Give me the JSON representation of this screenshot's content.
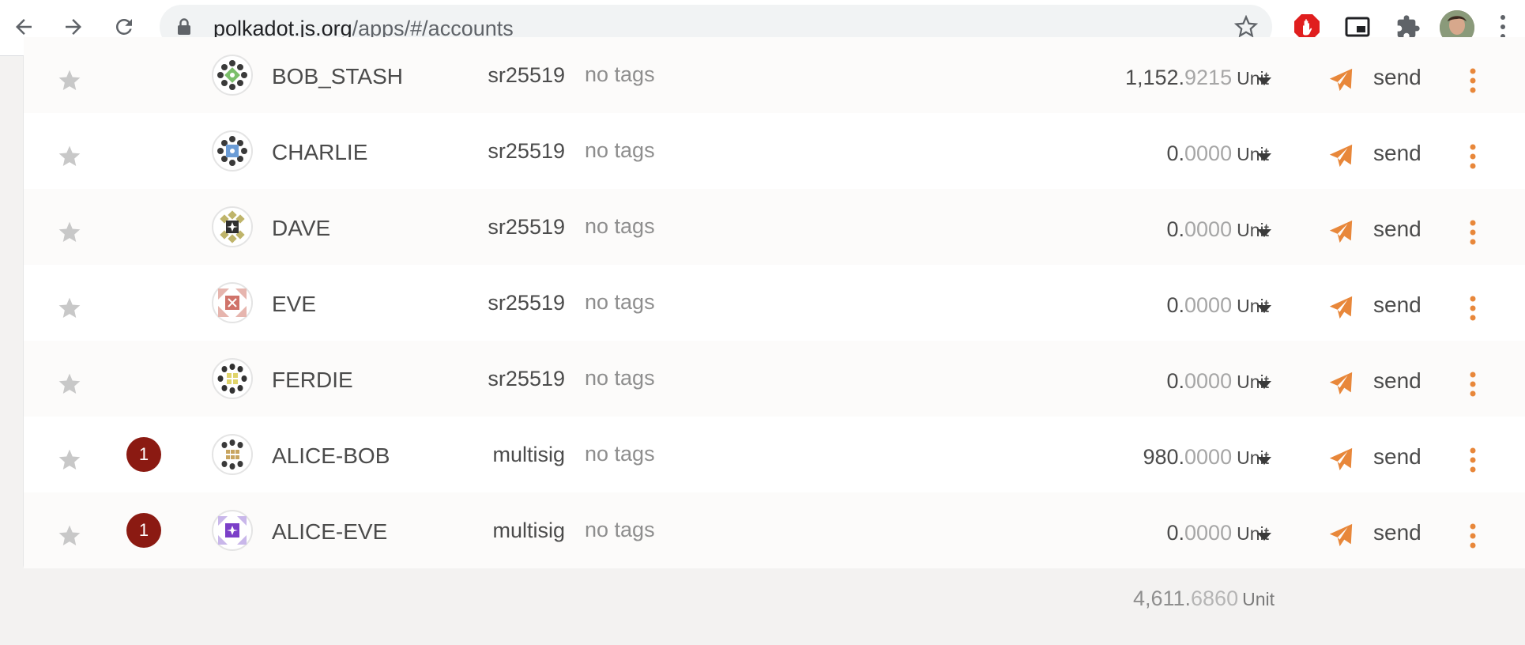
{
  "browser": {
    "url_host": "polkadot.js.org",
    "url_path": "/apps/#/accounts",
    "icons": [
      "back-arrow-icon",
      "forward-arrow-icon",
      "reload-icon",
      "lock-icon",
      "bookmark-star-icon",
      "adblock-hand-icon",
      "picture-in-picture-icon",
      "extensions-puzzle-icon",
      "profile-avatar",
      "chrome-menu-icon"
    ]
  },
  "colors": {
    "accent": "#e8873a",
    "badge": "#8b1a12",
    "star": "#c8c8c8",
    "adblock": "#e01e1e"
  },
  "accounts": [
    {
      "name": "BOB_STASH",
      "type": "sr25519",
      "tags": "no tags",
      "balance_int": "1,152.",
      "balance_dec": "9215",
      "unit": "Unit",
      "send": "send",
      "badge": "",
      "identicon": "green"
    },
    {
      "name": "CHARLIE",
      "type": "sr25519",
      "tags": "no tags",
      "balance_int": "0.",
      "balance_dec": "0000",
      "unit": "Unit",
      "send": "send",
      "badge": "",
      "identicon": "blue"
    },
    {
      "name": "DAVE",
      "type": "sr25519",
      "tags": "no tags",
      "balance_int": "0.",
      "balance_dec": "0000",
      "unit": "Unit",
      "send": "send",
      "badge": "",
      "identicon": "olive"
    },
    {
      "name": "EVE",
      "type": "sr25519",
      "tags": "no tags",
      "balance_int": "0.",
      "balance_dec": "0000",
      "unit": "Unit",
      "send": "send",
      "badge": "",
      "identicon": "pink"
    },
    {
      "name": "FERDIE",
      "type": "sr25519",
      "tags": "no tags",
      "balance_int": "0.",
      "balance_dec": "0000",
      "unit": "Unit",
      "send": "send",
      "badge": "",
      "identicon": "yellow"
    },
    {
      "name": "ALICE-BOB",
      "type": "multisig",
      "tags": "no tags",
      "balance_int": "980.",
      "balance_dec": "0000",
      "unit": "Unit",
      "send": "send",
      "badge": "1",
      "identicon": "tan"
    },
    {
      "name": "ALICE-EVE",
      "type": "multisig",
      "tags": "no tags",
      "balance_int": "0.",
      "balance_dec": "0000",
      "unit": "Unit",
      "send": "send",
      "badge": "1",
      "identicon": "purple"
    }
  ],
  "total": {
    "int": "4,611.",
    "dec": "6860",
    "unit": "Unit"
  }
}
